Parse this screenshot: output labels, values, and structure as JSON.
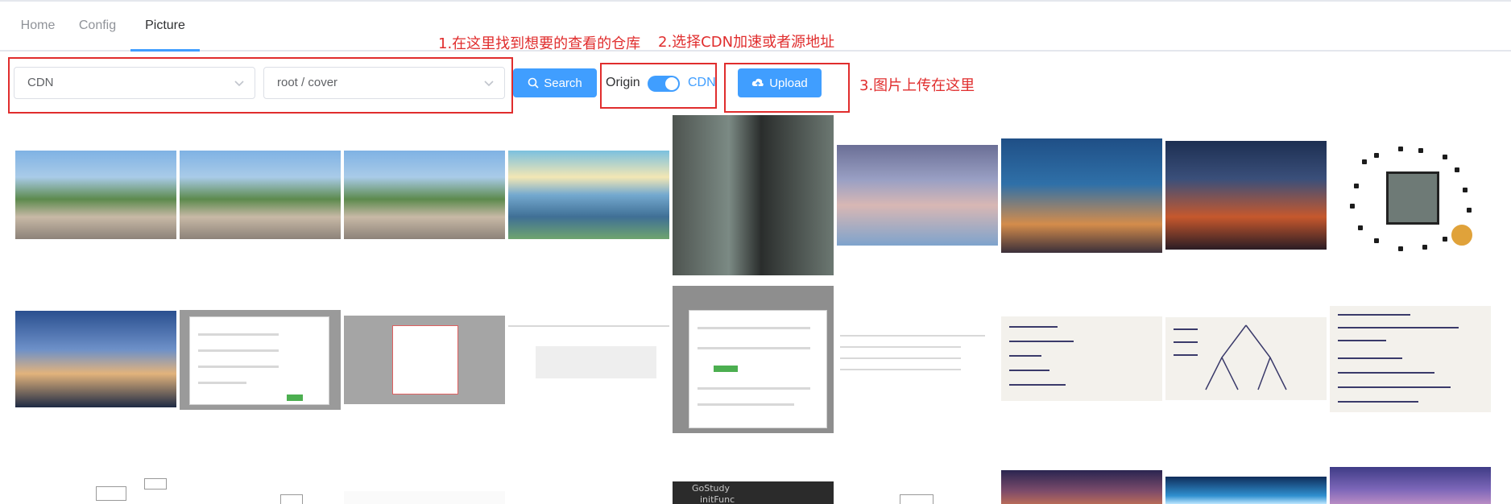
{
  "tabs": [
    {
      "label": "Home",
      "active": false
    },
    {
      "label": "Config",
      "active": false
    },
    {
      "label": "Picture",
      "active": true
    }
  ],
  "annotations": {
    "step1": "1.在这里找到想要的查看的仓库",
    "step2": "2.选择CDN加速或者源地址",
    "step3": "3.图片上传在这里"
  },
  "toolbar": {
    "source_select": "CDN",
    "repo_select": "root / cover",
    "search_label": "Search",
    "switch_left": "Origin",
    "switch_right": "CDN",
    "switch_on": true,
    "upload_label": "Upload"
  },
  "colors": {
    "primary": "#409eff",
    "annotation_red": "#e02d2d",
    "tab_text": "#909399"
  },
  "icons": [
    "search-icon",
    "upload-cloud-icon",
    "chevron-down-icon"
  ],
  "gallery": {
    "row3_tree": {
      "folder1": "GoStudy",
      "folder2": "initFunc"
    }
  }
}
